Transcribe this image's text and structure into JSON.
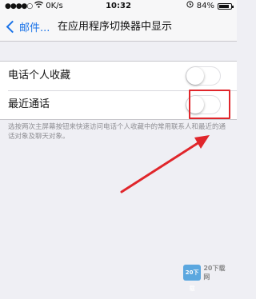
{
  "status_bar": {
    "carrier_speed": "0K/s",
    "time": "10:32",
    "battery_percent": "84%"
  },
  "nav": {
    "back_label": "邮件...",
    "title": "在应用程序切换器中显示"
  },
  "settings": {
    "rows": [
      {
        "label": "电话个人收藏",
        "toggle_on": false
      },
      {
        "label": "最近通话",
        "toggle_on": false
      }
    ],
    "footer": "选按两次主屏幕按钮来快速访问电话个人收藏中的常用联系人和最近的通话对象及聊天对象。"
  },
  "annotation": {
    "color": "#e0262b"
  },
  "watermark": {
    "logo_text": "20下载",
    "site_text": "20下载网"
  },
  "colors": {
    "accent": "#1a73e8",
    "background": "#efeff4"
  }
}
